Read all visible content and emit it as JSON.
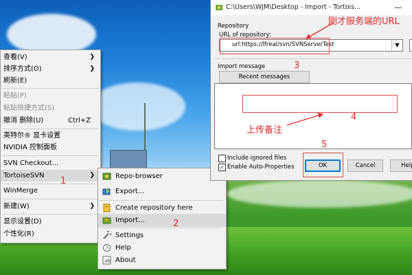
{
  "context_menu": {
    "items": [
      {
        "label": "查看(V)",
        "submenu": true
      },
      {
        "label": "排序方式(O)",
        "submenu": true
      },
      {
        "label": "刷新(E)"
      },
      {
        "label": "粘贴(P)",
        "disabled": true
      },
      {
        "label": "粘贴快捷方式(S)",
        "disabled": true
      },
      {
        "label": "撤消 删除(U)",
        "shortcut": "Ctrl+Z"
      },
      {
        "label": "英特尔® 显卡设置"
      },
      {
        "label": "NVIDIA 控制面板"
      },
      {
        "label": "SVN Checkout..."
      },
      {
        "label": "TortoiseSVN",
        "submenu": true,
        "active": true
      },
      {
        "label": "WinMerge"
      },
      {
        "label": "新建(W)",
        "submenu": true
      },
      {
        "label": "显示设置(D)"
      },
      {
        "label": "个性化(R)"
      }
    ]
  },
  "submenu": {
    "items": [
      {
        "label": "Repo-browser",
        "icon": "repo-browser-icon"
      },
      {
        "label": "Export...",
        "icon": "export-icon"
      },
      {
        "label": "Create repository here",
        "icon": "create-repository-icon"
      },
      {
        "label": "Import...",
        "icon": "import-icon",
        "active": true
      },
      {
        "label": "Settings",
        "icon": "settings-icon"
      },
      {
        "label": "Help",
        "icon": "help-icon"
      },
      {
        "label": "About",
        "icon": "about-icon"
      }
    ]
  },
  "dialog": {
    "title": "C:\\Users\\WJM\\Desktop - Import - Tortois...",
    "minimize": "—",
    "repository_group": "Repository",
    "url_label": "URL of repository:",
    "url_value": "url:https://lfreal/svn/SVNServerTest",
    "import_message_group": "Import message",
    "recent_messages_button": "Recent messages",
    "include_ignored_label": "Include ignored files",
    "include_ignored_checked": false,
    "auto_props_label": "Enable Auto-Properties",
    "auto_props_checked": true,
    "ok_button": "OK",
    "cancel_button": "Cancel",
    "help_button": "Help"
  },
  "annotations": {
    "n1": "1",
    "n2": "2",
    "n3": "3",
    "n4": "4",
    "n5": "5",
    "url_note": "刚才服务端的URL",
    "message_note": "上传备注",
    "color": "#e02b2b"
  }
}
